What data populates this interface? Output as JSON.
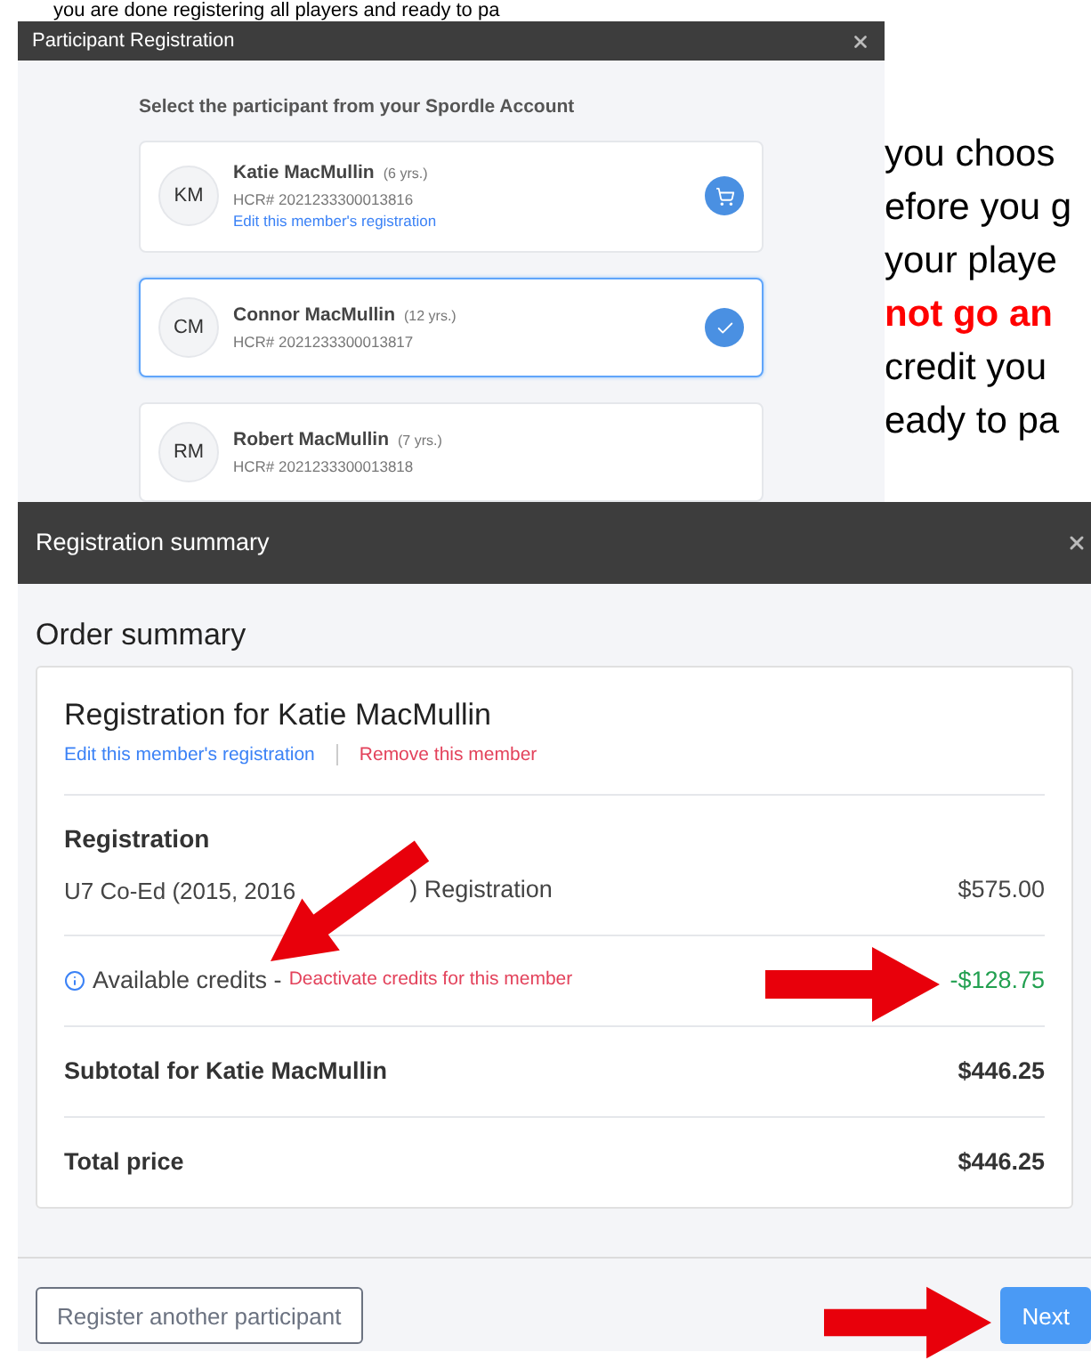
{
  "background_text": {
    "top_line": "you are done registering all players and ready to pa",
    "side_lines": [
      {
        "text": "you choos",
        "emphasis": false
      },
      {
        "text": "efore you g",
        "emphasis": false
      },
      {
        "text": "your playe",
        "emphasis": false
      },
      {
        "text": "not go an",
        "emphasis": true
      },
      {
        "text": "credit you",
        "emphasis": false
      },
      {
        "text": "eady to pa",
        "emphasis": false
      }
    ]
  },
  "participant_dialog": {
    "title": "Participant Registration",
    "prompt": "Select the participant from your Spordle Account",
    "participants": [
      {
        "initials": "KM",
        "name": "Katie MacMullin",
        "age": "(6 yrs.)",
        "hcr": "HCR# 2021233300013816",
        "link": "Edit this member's registration",
        "selected": false,
        "in_cart": true
      },
      {
        "initials": "CM",
        "name": "Connor MacMullin",
        "age": "(12 yrs.)",
        "hcr": "HCR# 2021233300013817",
        "selected": true,
        "in_cart": false
      },
      {
        "initials": "RM",
        "name": "Robert MacMullin",
        "age": "(7 yrs.)",
        "hcr": "HCR# 2021233300013818",
        "selected": false,
        "in_cart": false
      }
    ]
  },
  "summary_dialog": {
    "title": "Registration summary",
    "heading": "Order summary",
    "registration_title": "Registration for Katie MacMullin",
    "links": [
      {
        "label": "Edit this member's registration",
        "kind": "edit"
      },
      {
        "label": "Remove this member",
        "kind": "remove"
      }
    ],
    "sections": [
      {
        "kind": "item",
        "heading": "Registration",
        "text_before": "U7 Co-Ed (2015, 2016",
        "text_after": ") Registration",
        "amount": "$575.00"
      },
      {
        "kind": "credit",
        "label": "Available credits -",
        "action": "Deactivate credits for this member",
        "amount": "-$128.75"
      },
      {
        "kind": "total",
        "label": "Subtotal for Katie MacMullin",
        "amount": "$446.25"
      },
      {
        "kind": "total",
        "label": "Total price",
        "amount": "$446.25"
      }
    ],
    "buttons": [
      {
        "label": "Register another participant",
        "kind": "outline"
      },
      {
        "label": "Next",
        "kind": "primary"
      }
    ]
  }
}
